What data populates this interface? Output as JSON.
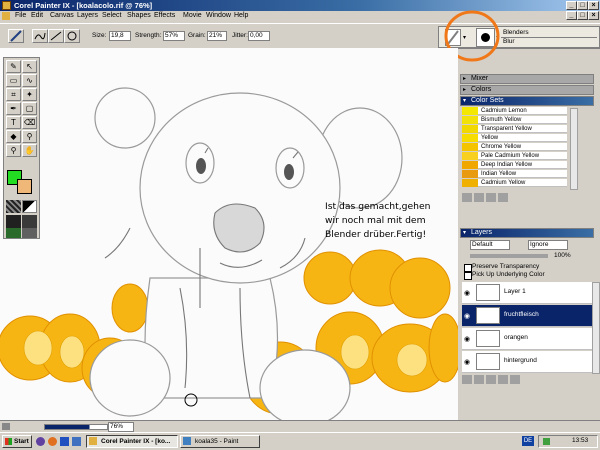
{
  "window": {
    "title": "Corel Painter IX - [koalacolo.rif @ 76%]"
  },
  "menu": [
    "File",
    "Edit",
    "Canvas",
    "Layers",
    "Select",
    "Shapes",
    "Effects",
    "Movie",
    "Window",
    "Help"
  ],
  "property_bar": {
    "size_label": "Size:",
    "size_value": "19,8",
    "strength_label": "Strength:",
    "strength_value": "57%",
    "grain_label": "Grain:",
    "grain_value": "21%",
    "jitter_label": "Jitter:",
    "jitter_value": "0,00"
  },
  "brush_selector": {
    "category": "Blenders",
    "variant": "Blur"
  },
  "annotation": [
    "Ist das gemacht,gehen",
    "wir noch mal mit dem",
    "Blender drüber.Fertig!"
  ],
  "palettes": {
    "mixer": "Mixer",
    "colors": "Colors",
    "color_sets": {
      "title": "Color Sets",
      "items": [
        {
          "name": "Cadmium Lemon",
          "color": "#f5e800"
        },
        {
          "name": "Bismuth Yellow",
          "color": "#f3e20a"
        },
        {
          "name": "Transparent Yellow",
          "color": "#f0d800"
        },
        {
          "name": "Yellow",
          "color": "#f7dc00"
        },
        {
          "name": "Chrome Yellow",
          "color": "#f5c400"
        },
        {
          "name": "Pale Cadmium Yellow",
          "color": "#f8d020"
        },
        {
          "name": "Deep Indian Yellow",
          "color": "#f0a800"
        },
        {
          "name": "Indian Yellow",
          "color": "#e89a10"
        },
        {
          "name": "Cadmium Yellow",
          "color": "#f0b000"
        }
      ]
    },
    "layers": {
      "title": "Layers",
      "composite_method": "Default",
      "depth": "Ignore",
      "opacity": "100%",
      "preserve_transparency": "Preserve Transparency",
      "pick_up_color": "Pick Up Underlying Color",
      "items": [
        {
          "name": "Layer 1",
          "selected": false
        },
        {
          "name": "fruchtfleisch",
          "selected": true
        },
        {
          "name": "orangen",
          "selected": false
        },
        {
          "name": "hintergrund",
          "selected": false
        }
      ]
    }
  },
  "status": {
    "zoom": "76%"
  },
  "taskbar": {
    "start": "Start",
    "tasks": [
      "Corel Painter IX - [ko...",
      "koala35 - Paint"
    ],
    "language": "DE",
    "clock": "13:53"
  },
  "colors": {
    "title_bar": "#0a246a",
    "main_color": "#22dd22",
    "secondary_color": "#f0b878"
  }
}
